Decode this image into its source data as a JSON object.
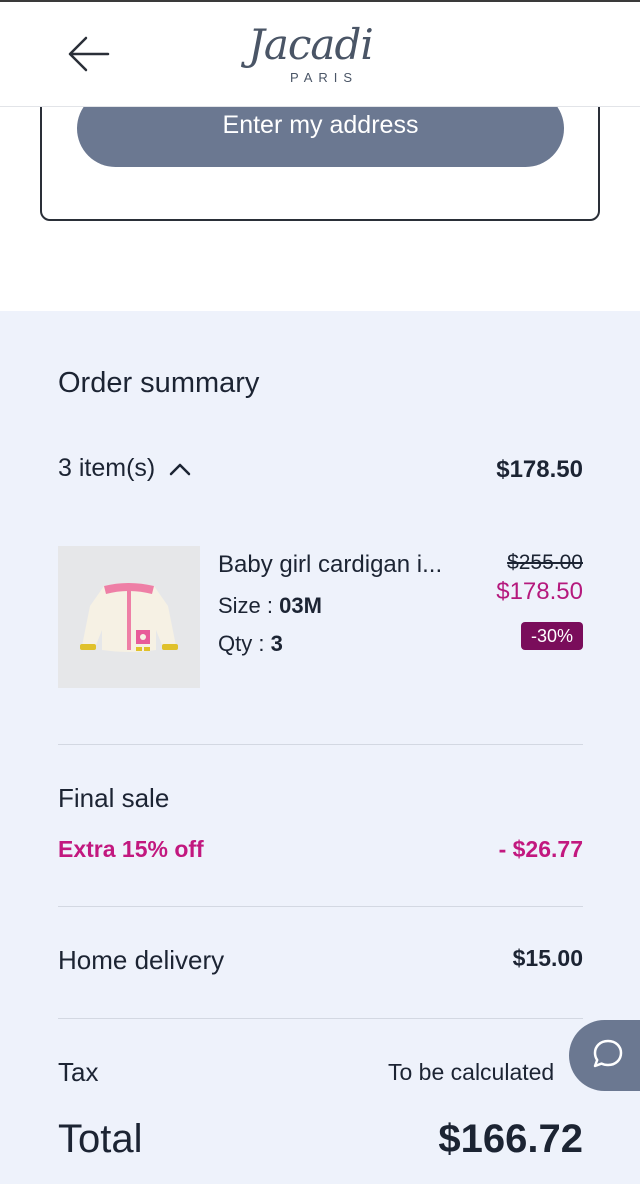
{
  "header": {
    "logo_text": "Jacadi",
    "logo_subtext": "PARIS"
  },
  "address": {
    "button_label": "Enter my address"
  },
  "summary": {
    "title": "Order summary",
    "items_label": "3 item(s)",
    "items_total": "$178.50",
    "product": {
      "name": "Baby girl cardigan i...",
      "size_label": "Size : ",
      "size_value": "03M",
      "qty_label": "Qty : ",
      "qty_value": "3",
      "old_price": "$255.00",
      "new_price": "$178.50",
      "discount": "-30%"
    },
    "final_sale_label": "Final sale",
    "extra_off_label": "Extra 15% off",
    "extra_off_amount": "- $26.77",
    "delivery_label": "Home delivery",
    "delivery_value": "$15.00",
    "tax_label": "Tax",
    "tax_value": "To be calculated",
    "total_label": "Total",
    "total_value": "$166.72"
  },
  "icons": {
    "back": "arrow-left-icon",
    "chevron": "chevron-up-icon",
    "chat": "chat-bubble-icon"
  },
  "colors": {
    "accent": "#c2187f",
    "badge": "#7a0d5b",
    "button": "#6b7891",
    "summary_bg": "#eef2fb"
  }
}
